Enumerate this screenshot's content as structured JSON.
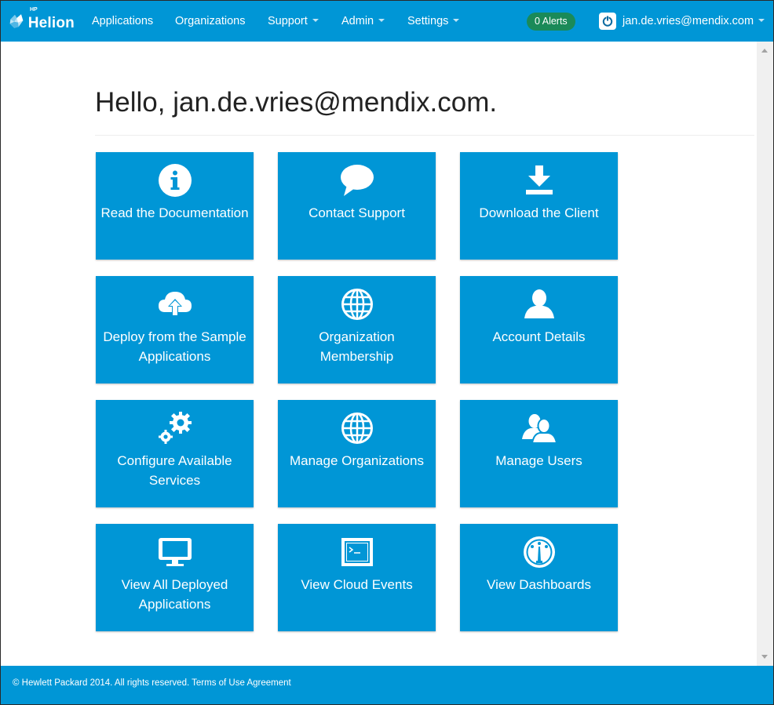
{
  "nav": {
    "logo_brand": "Helion",
    "logo_hp": "HP",
    "items": [
      "Applications",
      "Organizations",
      "Support",
      "Admin",
      "Settings"
    ],
    "alerts": "0 Alerts",
    "user_email": "jan.de.vries@mendix.com"
  },
  "main": {
    "greeting": "Hello, jan.de.vries@mendix.com."
  },
  "tiles": [
    {
      "label": "Read the Documentation",
      "icon": "info-icon"
    },
    {
      "label": "Contact Support",
      "icon": "chat-bubble-icon"
    },
    {
      "label": "Download the Client",
      "icon": "download-icon"
    },
    {
      "label": "Deploy from the Sample Applications",
      "icon": "cloud-upload-icon"
    },
    {
      "label": "Organization Membership",
      "icon": "globe-icon"
    },
    {
      "label": "Account Details",
      "icon": "user-icon"
    },
    {
      "label": "Configure Available Services",
      "icon": "gears-icon"
    },
    {
      "label": "Manage Organizations",
      "icon": "globe-icon"
    },
    {
      "label": "Manage Users",
      "icon": "users-icon"
    },
    {
      "label": "View All Deployed Applications",
      "icon": "monitor-icon"
    },
    {
      "label": "View Cloud Events",
      "icon": "terminal-icon"
    },
    {
      "label": "View Dashboards",
      "icon": "gauge-icon"
    }
  ],
  "footer": {
    "text": "© Hewlett Packard 2014. All rights reserved. Terms of Use Agreement"
  },
  "colors": {
    "brand": "#0096d6",
    "alert_badge": "#1a8a58"
  }
}
